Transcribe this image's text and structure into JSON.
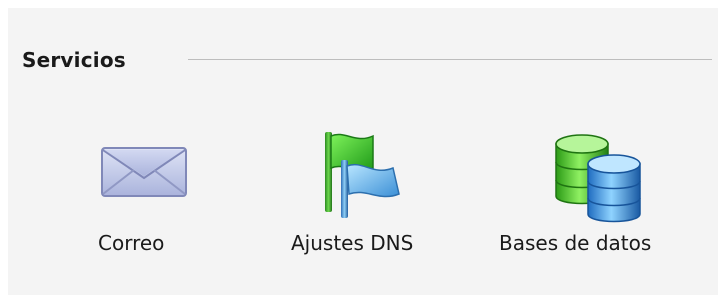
{
  "section": {
    "title": "Servicios"
  },
  "services": [
    {
      "label": "Correo",
      "icon": "envelope-icon"
    },
    {
      "label": "Ajustes DNS",
      "icon": "flags-icon"
    },
    {
      "label": "Bases de datos",
      "icon": "database-icon"
    }
  ]
}
